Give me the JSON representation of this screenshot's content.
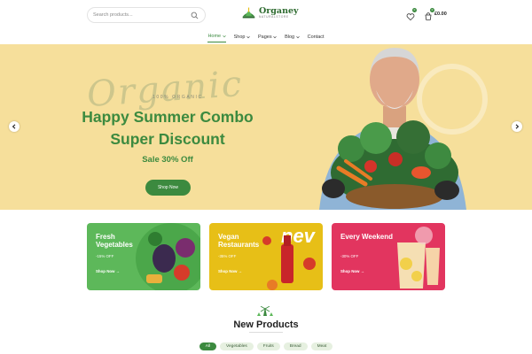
{
  "header": {
    "search_placeholder": "Search products...",
    "logo_name": "Organey",
    "logo_tagline": "NATURALSTORE",
    "cart_total": "£0.00",
    "wishlist_count": "0",
    "cart_count": "0"
  },
  "nav": [
    {
      "label": "Home",
      "active": true,
      "has_submenu": true
    },
    {
      "label": "Shop",
      "active": false,
      "has_submenu": true
    },
    {
      "label": "Pages",
      "active": false,
      "has_submenu": true
    },
    {
      "label": "Blog",
      "active": false,
      "has_submenu": true
    },
    {
      "label": "Contact",
      "active": false,
      "has_submenu": false
    }
  ],
  "hero": {
    "script_text": "Organic",
    "kicker": "100% ORGANIC",
    "title_line1": "Happy Summer Combo",
    "title_line2": "Super Discount",
    "sale": "Sale 30% Off",
    "button": "Shop Now",
    "background": "#f6df9b"
  },
  "promos": [
    {
      "title": "Fresh Vegetables",
      "discount": "-15% OFF",
      "link": "Shop Now",
      "color": "#5db85a"
    },
    {
      "title": "Vegan Restaurants",
      "discount": "-35% OFF",
      "link": "Shop Now",
      "color": "#e7bf17"
    },
    {
      "title": "Every Weekend",
      "discount": "-30% OFF",
      "link": "Shop Now",
      "color": "#e2355f"
    }
  ],
  "products": {
    "title": "New Products",
    "filters": [
      {
        "label": "All",
        "active": true
      },
      {
        "label": "Vegetables",
        "active": false
      },
      {
        "label": "Fruits",
        "active": false
      },
      {
        "label": "Bread",
        "active": false
      },
      {
        "label": "Meat",
        "active": false
      }
    ]
  },
  "colors": {
    "accent": "#3c8a3f"
  }
}
